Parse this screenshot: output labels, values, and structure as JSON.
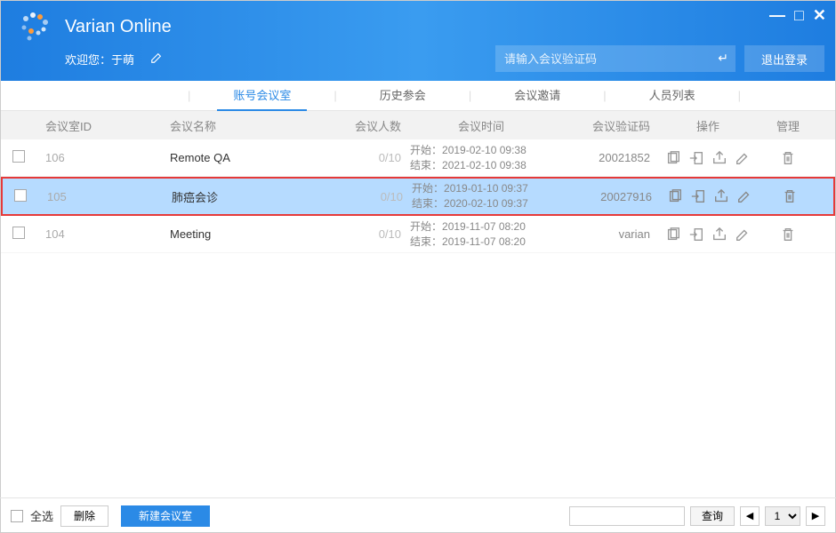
{
  "header": {
    "title": "Varian Online",
    "welcome_prefix": "欢迎您：",
    "user": "于萌",
    "search_placeholder": "请输入会议验证码",
    "logout": "退出登录"
  },
  "tabs": [
    "账号会议室",
    "历史参会",
    "会议邀请",
    "人员列表"
  ],
  "active_tab": 0,
  "columns": {
    "id": "会议室ID",
    "name": "会议名称",
    "count": "会议人数",
    "time": "会议时间",
    "code": "会议验证码",
    "ops": "操作",
    "manage": "管理"
  },
  "time_labels": {
    "start": "开始：",
    "end": "结束："
  },
  "rows": [
    {
      "id": "106",
      "name": "Remote QA",
      "count": "0/10",
      "start": "2019-02-10 09:38",
      "end": "2021-02-10 09:38",
      "code": "20021852",
      "selected": false
    },
    {
      "id": "105",
      "name": "肺癌会诊",
      "count": "0/10",
      "start": "2019-01-10 09:37",
      "end": "2020-02-10 09:37",
      "code": "20027916",
      "selected": true
    },
    {
      "id": "104",
      "name": "Meeting",
      "count": "0/10",
      "start": "2019-11-07 08:20",
      "end": "2019-11-07 08:20",
      "code": "varian",
      "selected": false
    }
  ],
  "footer": {
    "select_all": "全选",
    "delete": "删除",
    "new_room": "新建会议室",
    "query": "查询",
    "page": "1"
  }
}
